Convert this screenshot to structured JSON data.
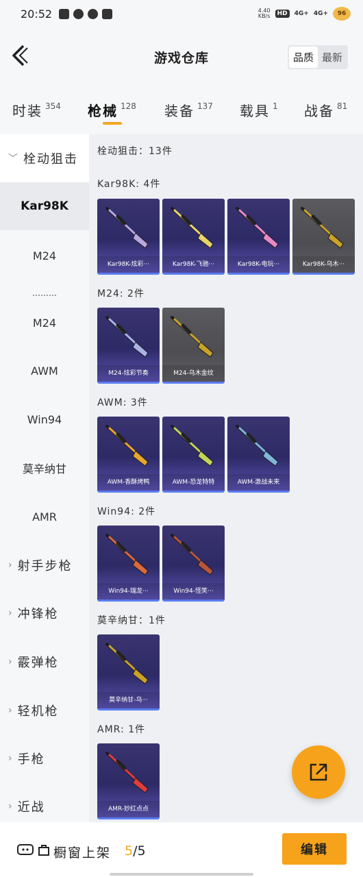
{
  "status_bar": {
    "time": "20:52",
    "net_speed_top": "4.40",
    "net_speed_bottom": "KB/s",
    "hd": "HD",
    "signal_1": "4G+",
    "signal_2": "4G+",
    "battery": "96"
  },
  "header": {
    "title": "游戏仓库",
    "sort_quality": "品质",
    "sort_latest": "最新"
  },
  "tabs": [
    {
      "label": "时装",
      "count": "354"
    },
    {
      "label": "枪械",
      "count": "128"
    },
    {
      "label": "装备",
      "count": "137"
    },
    {
      "label": "载具",
      "count": "1"
    },
    {
      "label": "战备",
      "count": "81"
    }
  ],
  "sidebar": {
    "items": [
      {
        "label": "栓动狙击"
      },
      {
        "label": "Kar98K"
      },
      {
        "label": "M24"
      },
      {
        "label": "M24"
      },
      {
        "label": "AWM"
      },
      {
        "label": "Win94"
      },
      {
        "label": "莫辛纳甘"
      },
      {
        "label": "AMR"
      },
      {
        "label": "射手步枪"
      },
      {
        "label": "冲锋枪"
      },
      {
        "label": "霰弹枪"
      },
      {
        "label": "轻机枪"
      },
      {
        "label": "手枪"
      },
      {
        "label": "近战"
      }
    ]
  },
  "content": {
    "summary": "栓动狙击：13件",
    "groups": [
      {
        "title": "Kar98K: 4件",
        "items": [
          {
            "label": "Kar98K-炫彩···",
            "palette": "#b9a7e0"
          },
          {
            "label": "Kar98K-飞驰···",
            "palette": "#e8d36a"
          },
          {
            "label": "Kar98K-电玩···",
            "palette": "#e889c6"
          },
          {
            "label": "Kar98K-乌木···",
            "palette": "#c9a227"
          }
        ]
      },
      {
        "title": "M24: 2件",
        "items": [
          {
            "label": "M24-炫彩节奏",
            "palette": "#a9b3e8"
          },
          {
            "label": "M24-乌木金纹",
            "palette": "#c9a227"
          }
        ]
      },
      {
        "title": "AWM: 3件",
        "items": [
          {
            "label": "AWM-香酥烤鸭",
            "palette": "#e9a62a"
          },
          {
            "label": "AWM-恐龙特特",
            "palette": "#c3d45a"
          },
          {
            "label": "AWM-激战未来",
            "palette": "#7fb6d9"
          }
        ]
      },
      {
        "title": "Win94: 2件",
        "items": [
          {
            "label": "Win94-瑞龙···",
            "palette": "#d86a3a"
          },
          {
            "label": "Win94-怪笑···",
            "palette": "#b8553a"
          }
        ]
      },
      {
        "title": "莫辛纳甘：1件",
        "items": [
          {
            "label": "莫辛纳甘-乌···",
            "palette": "#c9a227"
          }
        ]
      },
      {
        "title": "AMR: 1件",
        "items": [
          {
            "label": "AMR-妙红点点",
            "palette": "#e03c3c"
          }
        ]
      }
    ]
  },
  "bottom_bar": {
    "showcase_label": "橱窗上架",
    "count_current": "5",
    "count_total": "/5",
    "edit_label": "编辑"
  }
}
